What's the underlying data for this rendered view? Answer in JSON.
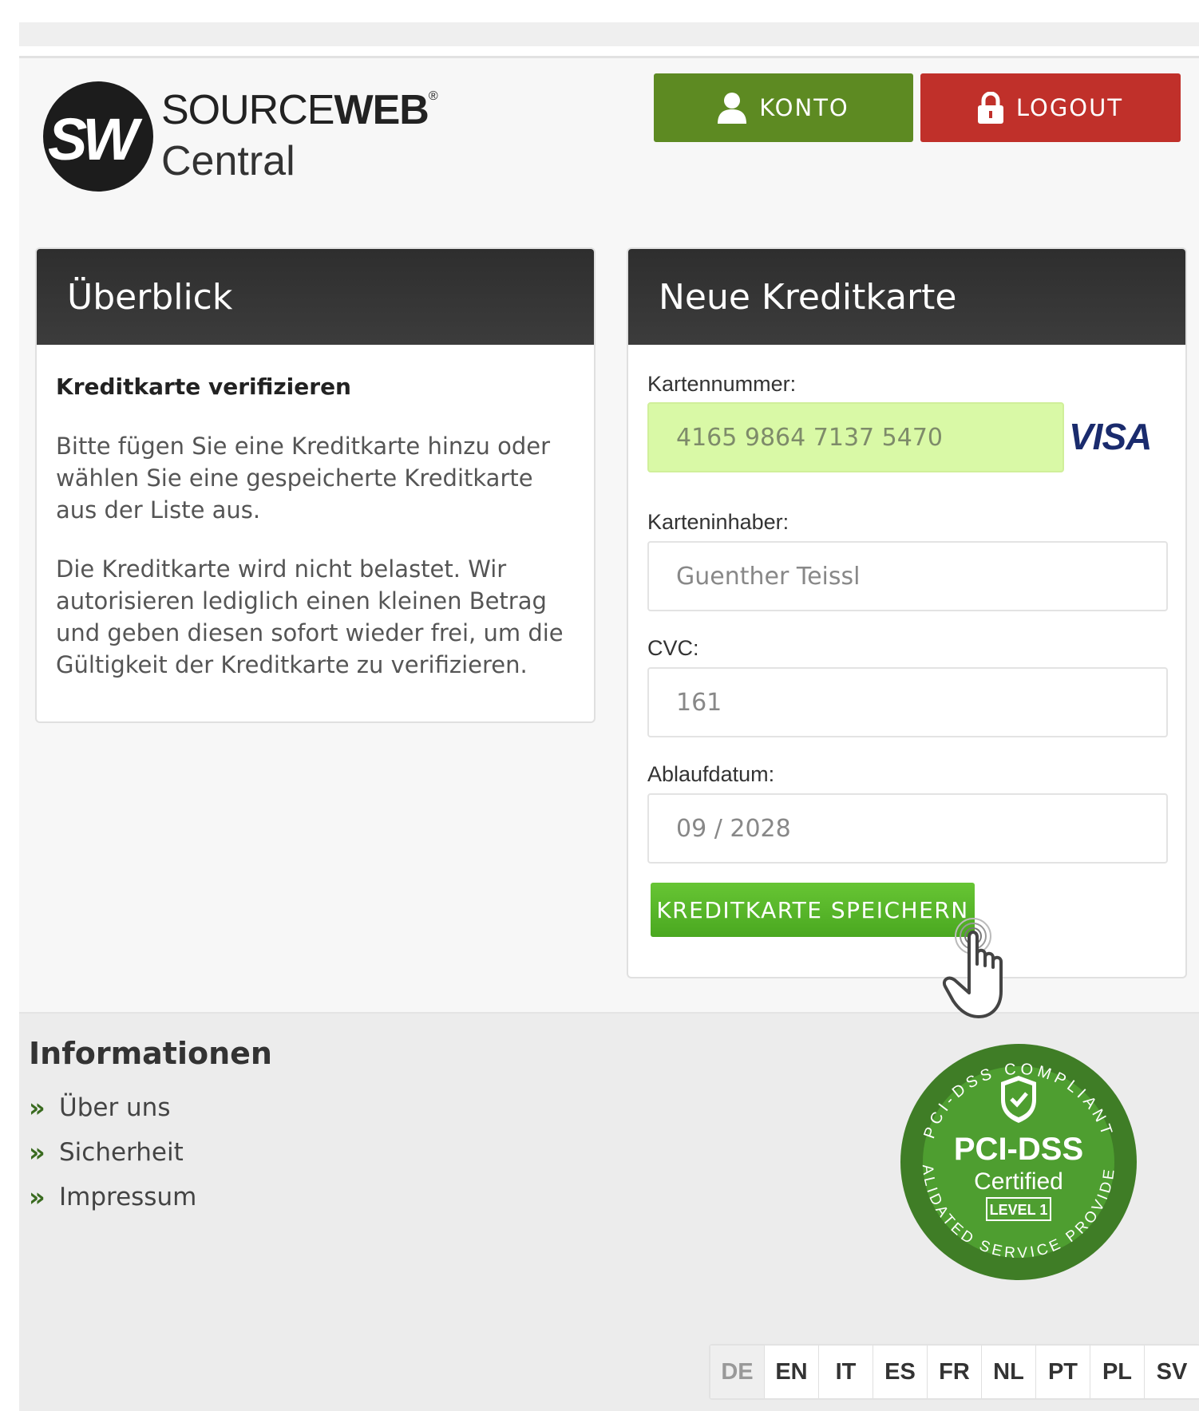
{
  "header": {
    "logo": {
      "brand": "SOURCE",
      "brand_bold": "WEB",
      "registered": "®",
      "sub": "Central",
      "mark": "SW"
    },
    "konto_label": "KONTO",
    "logout_label": "LOGOUT"
  },
  "overview": {
    "title": "Überblick",
    "subtitle": "Kreditkarte verifizieren",
    "p1": "Bitte fügen Sie eine Kreditkarte hinzu oder wählen Sie eine gespeicherte Kreditkarte aus der Liste aus.",
    "p2": "Die Kreditkarte wird nicht belastet. Wir autorisieren lediglich einen kleinen Betrag und geben diesen sofort wieder frei, um die Gültigkeit der Kreditkarte zu verifizieren."
  },
  "card_form": {
    "title": "Neue Kreditkarte",
    "number_label": "Kartennummer:",
    "number_value": "4165 9864 7137 5470",
    "brand": "VISA",
    "holder_label": "Karteninhaber:",
    "holder_value": "Guenther Teissl",
    "cvc_label": "CVC:",
    "cvc_value": "161",
    "expiry_label": "Ablaufdatum:",
    "expiry_value": "09 / 2028",
    "save_label": "KREDITKARTE SPEICHERN"
  },
  "footer": {
    "info_title": "Informationen",
    "links": [
      "Über uns",
      "Sicherheit",
      "Impressum"
    ],
    "badge": {
      "ring_top": "PCI-DSS COMPLIANT",
      "ring_bottom": "VALIDATED SERVICE PROVIDER",
      "main": "PCI-DSS",
      "sub": "Certified",
      "level": "LEVEL 1"
    },
    "languages": [
      "DE",
      "EN",
      "IT",
      "ES",
      "FR",
      "NL",
      "PT",
      "PL",
      "SV"
    ],
    "active_language": "DE"
  },
  "colors": {
    "konto": "#5d8a22",
    "logout": "#c0302a",
    "save": "#4aa820",
    "card_field": "#d9f9a6",
    "badge_green": "#3f8a2a"
  }
}
